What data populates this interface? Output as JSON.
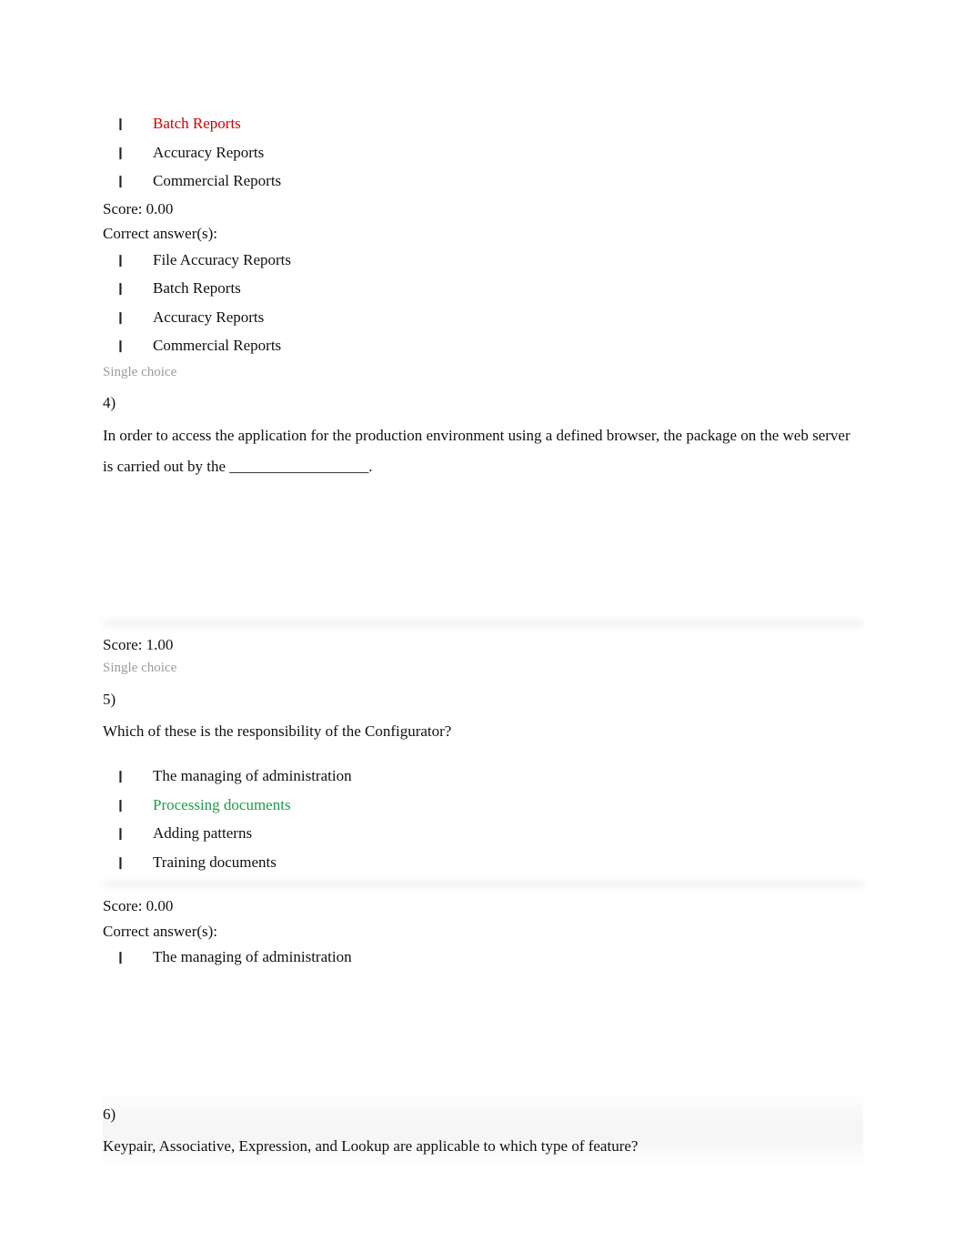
{
  "q3_partial": {
    "options": [
      {
        "text": "Batch Reports",
        "state": "wrong"
      },
      {
        "text": "Accuracy Reports",
        "state": "plain"
      },
      {
        "text": "Commercial Reports",
        "state": "plain"
      }
    ],
    "score_label": "Score: 0.00",
    "correct_label": "Correct answer(s):",
    "correct_options": [
      {
        "text": "File Accuracy Reports"
      },
      {
        "text": "Batch Reports"
      },
      {
        "text": "Accuracy Reports"
      },
      {
        "text": "Commercial Reports"
      }
    ]
  },
  "q4": {
    "type_label": "Single choice",
    "number": "4)",
    "text": "In order to access the application for the production environment using a defined browser, the package on the web server is carried out by the __________________.",
    "score_label": "Score: 1.00"
  },
  "q5": {
    "type_label": "Single choice",
    "number": "5)",
    "text": "Which of these is the responsibility of the Configurator?",
    "options": [
      {
        "text": "The managing of administration",
        "state": "plain"
      },
      {
        "text": "Processing documents",
        "state": "selected-right"
      },
      {
        "text": "Adding patterns",
        "state": "plain"
      },
      {
        "text": "Training documents",
        "state": "plain"
      }
    ],
    "score_label": "Score: 0.00",
    "correct_label": "Correct answer(s):",
    "correct_options": [
      {
        "text": "The managing of administration"
      }
    ]
  },
  "q6": {
    "number": "6)",
    "text": "Keypair, Associative, Expression, and Lookup are applicable to which type of feature?"
  },
  "bullet_glyph": "❙"
}
